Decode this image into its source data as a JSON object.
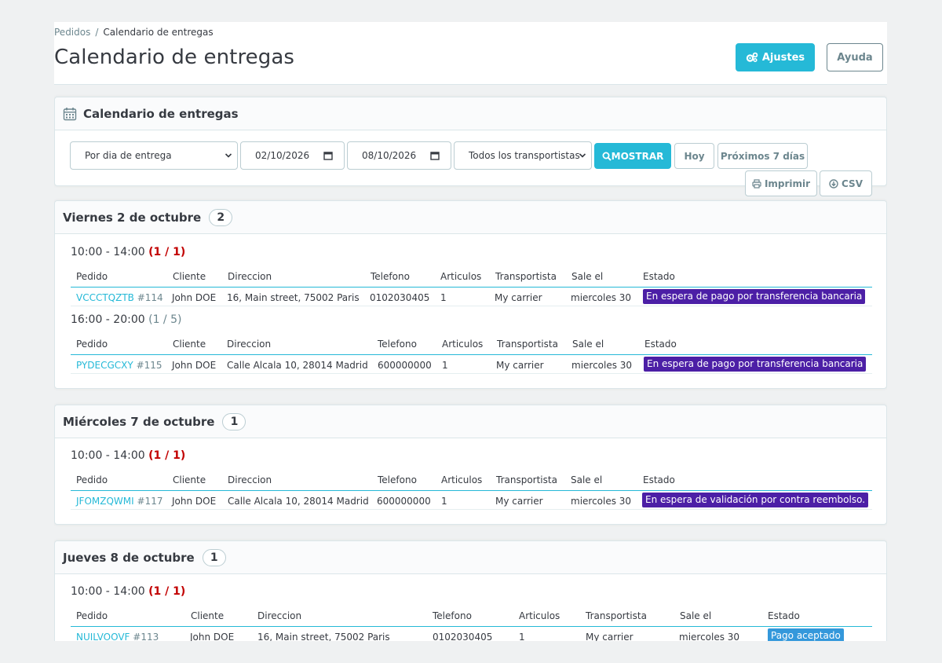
{
  "breadcrumb": {
    "parent": "Pedidos",
    "separator": "/",
    "current": "Calendario de entregas"
  },
  "page_title": "Calendario de entregas",
  "toolbar": {
    "settings_label": "Ajustes",
    "help_label": "Ayuda"
  },
  "filters": {
    "panel_title": "Calendario de entregas",
    "date_mode": "Por dia de entrega",
    "date_from": "02/10/2026",
    "date_to": "08/10/2026",
    "carrier": "Todos los transportistas",
    "show_label": "MOSTRAR",
    "today_label": "Hoy",
    "next7_label": "Próximos 7 días",
    "print_label": "Imprimir",
    "csv_label": "CSV"
  },
  "columns": [
    "Pedido",
    "Cliente",
    "Direccion",
    "Telefono",
    "Articulos",
    "Transportista",
    "Sale el",
    "Estado"
  ],
  "colors": {
    "accent": "#25b9d7",
    "status_waiting": "#4c1fa6",
    "status_paid": "#3498db",
    "ratio_full": "#c20000"
  },
  "days": [
    {
      "title": "Viernes 2 de octubre",
      "count": "2",
      "slots": [
        {
          "time": "10:00 - 14:00",
          "ratio": "(1 / 1)",
          "orders": [
            {
              "ref": "VCCCTQZTB",
              "id": "#114",
              "customer": "John DOE",
              "address": "16, Main street, 75002 Paris",
              "phone": "0102030405",
              "items": "1",
              "carrier": "My carrier",
              "ships": "miercoles 30",
              "status": "En espera de pago por transferencia bancaria"
            }
          ]
        },
        {
          "time": "16:00 - 20:00",
          "ratio": "(1 / 5)",
          "orders": [
            {
              "ref": "PYDECGCXY",
              "id": "#115",
              "customer": "John DOE",
              "address": "Calle Alcala 10, 28014 Madrid",
              "phone": "600000000",
              "items": "1",
              "carrier": "My carrier",
              "ships": "miercoles 30",
              "status": "En espera de pago por transferencia bancaria"
            }
          ]
        }
      ]
    },
    {
      "title": "Miércoles 7 de octubre",
      "count": "1",
      "slots": [
        {
          "time": "10:00 - 14:00",
          "ratio": "(1 / 1)",
          "orders": [
            {
              "ref": "JFOMZQWMI",
              "id": "#117",
              "customer": "John DOE",
              "address": "Calle Alcala 10, 28014 Madrid",
              "phone": "600000000",
              "items": "1",
              "carrier": "My carrier",
              "ships": "miercoles 30",
              "status": "En espera de validación por contra reembolso."
            }
          ]
        }
      ]
    },
    {
      "title": "Jueves 8 de octubre",
      "count": "1",
      "slots": [
        {
          "time": "10:00 - 14:00",
          "ratio": "(1 / 1)",
          "orders": [
            {
              "ref": "NUILVOOVF",
              "id": "#113",
              "customer": "John DOE",
              "address": "16, Main street, 75002 Paris",
              "phone": "0102030405",
              "items": "1",
              "carrier": "My carrier",
              "ships": "miercoles 30",
              "status": "Pago aceptado"
            }
          ]
        }
      ]
    }
  ]
}
